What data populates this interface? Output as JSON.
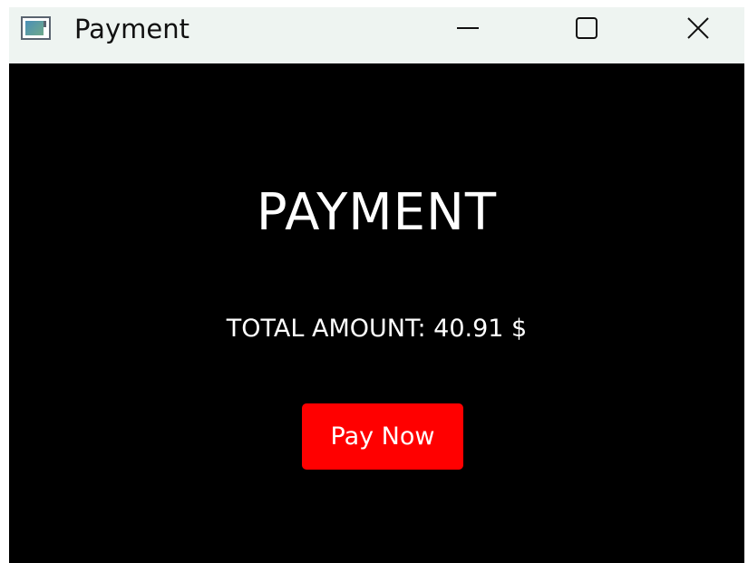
{
  "window": {
    "title": "Payment",
    "icon": "app-window-icon",
    "controls": {
      "minimize": "minimize-icon",
      "maximize": "maximize-icon",
      "close": "close-icon"
    }
  },
  "main": {
    "heading": "PAYMENT",
    "total_label": "TOTAL AMOUNT: 40.91 $",
    "pay_button_label": "Pay Now"
  },
  "colors": {
    "background": "#000000",
    "titlebar": "#eef4f1",
    "text": "#ffffff",
    "pay_button": "#ff0000"
  }
}
